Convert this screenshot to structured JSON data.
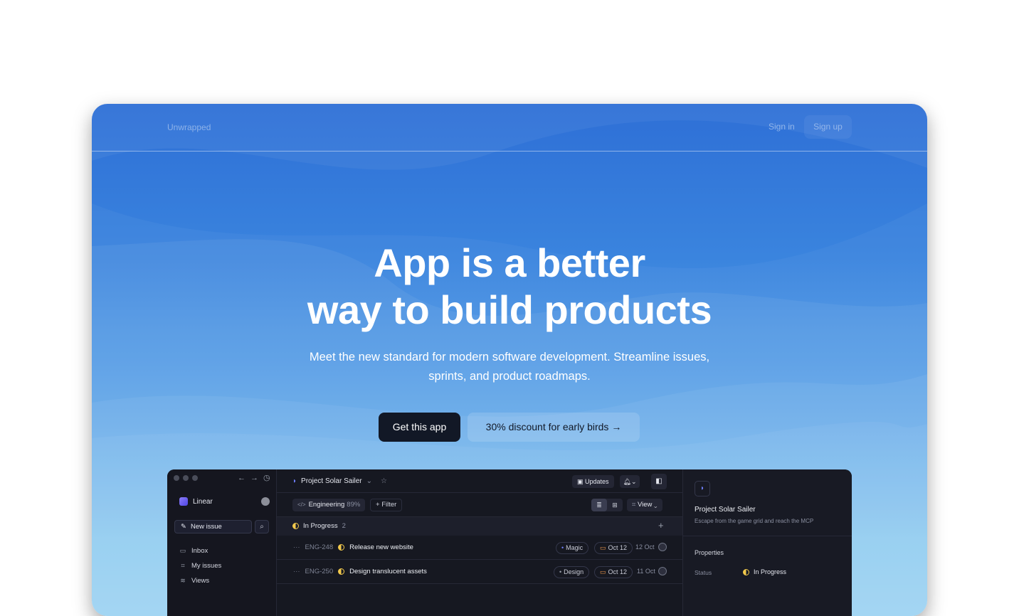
{
  "nav": {
    "brand": "Unwrapped",
    "signin": "Sign in",
    "signup": "Sign up"
  },
  "hero": {
    "title_line1": "App is a better",
    "title_line2": "way to build products",
    "subtitle": "Meet the new standard for modern software development. Streamline issues, sprints, and product roadmaps.",
    "cta_primary": "Get this app",
    "cta_secondary": "30% discount for early birds →"
  },
  "app": {
    "sidebar": {
      "workspace": "Linear",
      "new_issue": "New issue",
      "items": [
        {
          "label": "Inbox",
          "icon": "inbox-icon"
        },
        {
          "label": "My issues",
          "icon": "target-icon"
        },
        {
          "label": "Views",
          "icon": "layers-icon"
        }
      ]
    },
    "project": {
      "title": "Project Solar Sailer",
      "updates": "Updates"
    },
    "filters": {
      "team": "Engineering",
      "team_pct": "89%",
      "filter": "Filter",
      "view": "View"
    },
    "group": {
      "title": "In Progress",
      "count": "2"
    },
    "issues": [
      {
        "id": "ENG-248",
        "title": "Release new website",
        "label": "Magic",
        "due": "Oct 12",
        "date": "12 Oct"
      },
      {
        "id": "ENG-250",
        "title": "Design translucent assets",
        "label": "Design",
        "due": "Oct 12",
        "date": "11 Oct"
      }
    ],
    "detail": {
      "title": "Project Solar Sailer",
      "description": "Escape from the game grid and reach the MCP",
      "properties": "Properties",
      "status_label": "Status",
      "status_value": "In Progress"
    }
  },
  "colors": {
    "primary_button": "#121826",
    "status_in_progress": "#f2c94c",
    "accent": "#6d7cf5"
  }
}
